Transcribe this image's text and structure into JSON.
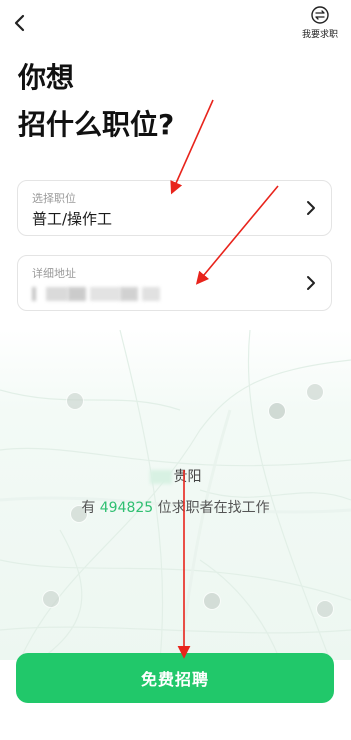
{
  "topbar": {
    "back_icon": "chevron-left-icon",
    "switch_icon": "switch-arrows-icon",
    "switch_label": "我要求职"
  },
  "heading": {
    "line1": "你想",
    "line2": "招什么职位?"
  },
  "job_field": {
    "label": "选择职位",
    "value": "普工/操作工"
  },
  "address_field": {
    "label": "详细地址",
    "value_blurred": true
  },
  "map": {
    "city_suffix": "贵阳",
    "stats_prefix": "有",
    "stats_count": "494825",
    "stats_suffix": "位求职者在找工作"
  },
  "primary_action": {
    "label": "免费招聘"
  },
  "colors": {
    "accent": "#21c86a",
    "count_text": "#2fbf71",
    "annotation_arrow": "#e8241c"
  }
}
